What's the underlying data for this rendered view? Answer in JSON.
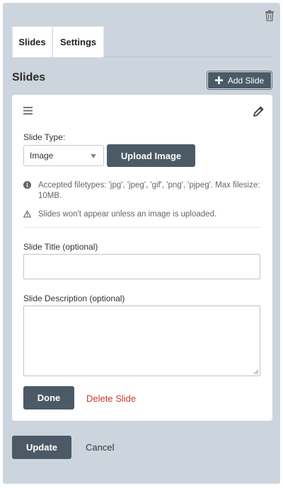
{
  "tabs": [
    {
      "label": "Slides"
    },
    {
      "label": "Settings"
    }
  ],
  "section": {
    "heading": "Slides",
    "add_label": "Add Slide"
  },
  "slide": {
    "type_label": "Slide Type:",
    "type_value": "Image",
    "upload_label": "Upload Image",
    "filetypes_note": "Accepted filetypes: 'jpg', 'jpeg', 'gif', 'png', 'pjpeg'. Max filesize: 10MB.",
    "warning_note": "Slides won't appear unless an image is uploaded.",
    "title_label": "Slide Title (optional)",
    "title_value": "",
    "description_label": "Slide Description (optional)",
    "description_value": "",
    "done_label": "Done",
    "delete_label": "Delete Slide"
  },
  "footer": {
    "update_label": "Update",
    "cancel_label": "Cancel"
  },
  "icons": {
    "trash": "trash-icon",
    "plus": "plus-icon",
    "handle": "drag-handle-icon",
    "pencil": "pencil-icon",
    "info": "info-icon",
    "warning": "warning-icon"
  },
  "colors": {
    "panel_bg": "#ccd5dd",
    "button_bg": "#4b5a66",
    "delete_red": "#c33a2e"
  }
}
